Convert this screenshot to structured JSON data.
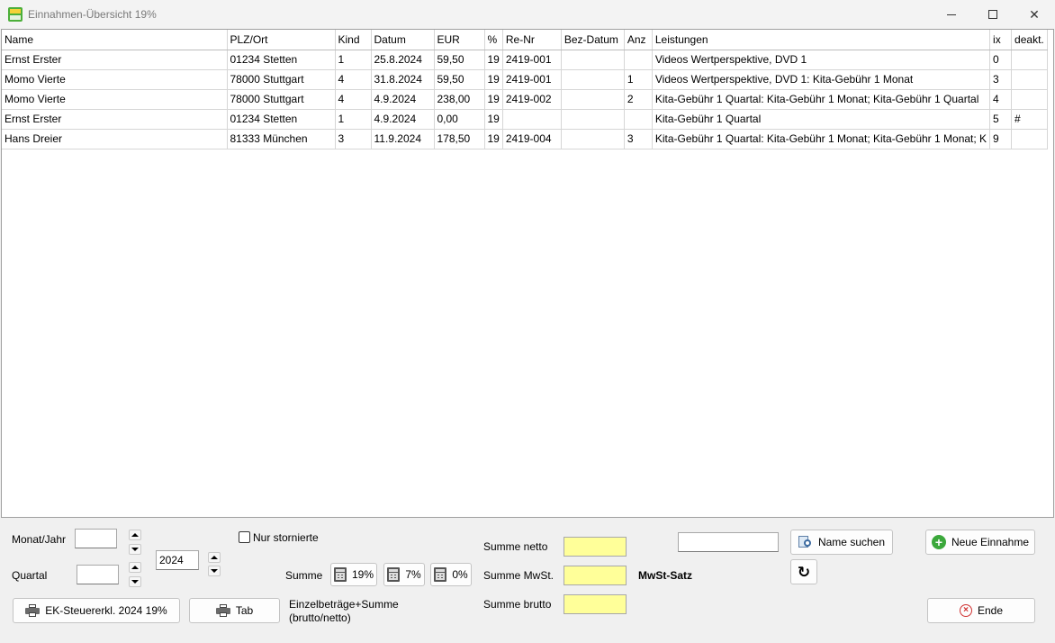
{
  "window": {
    "title": "Einnahmen-Übersicht 19%",
    "minimize": "—",
    "maximize": "□",
    "close": "✕"
  },
  "table": {
    "columns": [
      "Name",
      "PLZ/Ort",
      "Kind",
      "Datum",
      "EUR",
      "%",
      "Re-Nr",
      "Bez-Datum",
      "Anz",
      "Leistungen",
      "ix",
      "deakt."
    ],
    "rows": [
      [
        "Ernst Erster",
        "01234 Stetten",
        "1",
        "25.8.2024",
        "59,50",
        "19",
        "2419-001",
        "",
        "",
        "Videos Wertperspektive, DVD 1",
        "0",
        ""
      ],
      [
        "Momo Vierte",
        "78000 Stuttgart",
        "4",
        "31.8.2024",
        "59,50",
        "19",
        "2419-001",
        "",
        "1",
        "Videos Wertperspektive, DVD 1: Kita-Gebühr 1 Monat",
        "3",
        ""
      ],
      [
        "Momo Vierte",
        "78000 Stuttgart",
        "4",
        "4.9.2024",
        "238,00",
        "19",
        "2419-002",
        "",
        "2",
        "Kita-Gebühr 1 Quartal: Kita-Gebühr 1 Monat; Kita-Gebühr 1 Quartal",
        "4",
        ""
      ],
      [
        "Ernst Erster",
        "01234 Stetten",
        "1",
        "4.9.2024",
        "0,00",
        "19",
        "",
        "",
        "",
        "Kita-Gebühr 1 Quartal",
        "5",
        "#"
      ],
      [
        "Hans Dreier",
        "81333 München",
        "3",
        "11.9.2024",
        "178,50",
        "19",
        "2419-004",
        "",
        "3",
        "Kita-Gebühr 1 Quartal: Kita-Gebühr 1 Monat; Kita-Gebühr 1 Monat; K",
        "9",
        ""
      ]
    ]
  },
  "filters": {
    "monat_jahr_label": "Monat/Jahr",
    "monat_value": "",
    "quartal_label": "Quartal",
    "quartal_value": "",
    "year_value": "2024",
    "nur_stornierte_label": "Nur stornierte"
  },
  "summe": {
    "label": "Summe",
    "btn_19": "19%",
    "btn_7": "7%",
    "btn_0": "0%",
    "netto_label": "Summe netto",
    "mwst_label": "Summe MwSt.",
    "brutto_label": "Summe brutto",
    "mwst_satz_label": "MwSt-Satz",
    "einzel_line1": "Einzelbeträge+Summe",
    "einzel_line2": "(brutto/netto)"
  },
  "actions": {
    "name_input": "",
    "name_suchen": "Name suchen",
    "neue_einnahme": "Neue Einnahme",
    "ende": "Ende",
    "ek_steuer": "EK-Steuererkl. 2024 19%",
    "tab": "Tab"
  },
  "colors": {
    "yellow_field": "#ffff99",
    "add_green": "#3ba83b",
    "end_red": "#d03030"
  }
}
